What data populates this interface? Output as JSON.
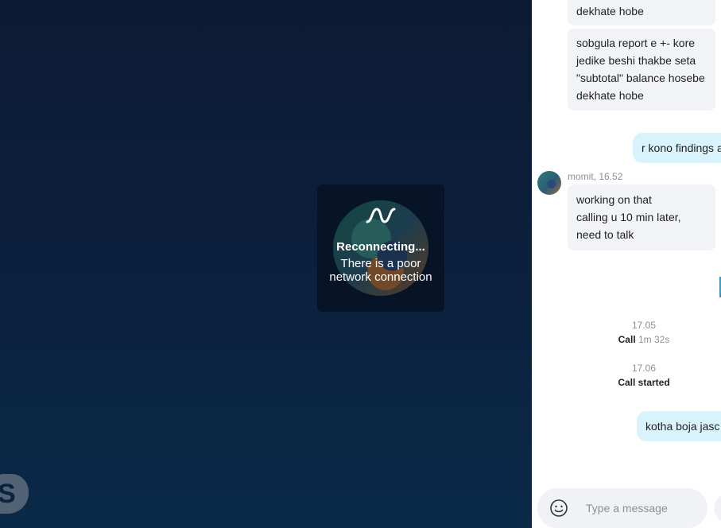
{
  "call": {
    "status_title": "Reconnecting...",
    "status_message": "There is a poor network connection",
    "logo_letter": "S"
  },
  "chat": {
    "messages_in_top": [
      "dekhate hobe",
      "sobgula report e +- kore jedike beshi thakbe seta \"subtotal\" balance hosebe dekhate hobe"
    ],
    "out_1": "r kono findings a",
    "sender": {
      "name_time": "momit, 16.52"
    },
    "message_in_2": "working on that calling u 10 min later, need to talk",
    "events": [
      {
        "time": "17.05",
        "label": "Call",
        "detail": "1m 32s"
      },
      {
        "time": "17.06",
        "label": "Call started",
        "detail": ""
      }
    ],
    "out_2": "kotha boja jasc",
    "composer": {
      "placeholder": "Type a message"
    }
  },
  "icons": {
    "wave": "audio-wave-icon",
    "emoji": "smiley-icon",
    "logo": "skype-logo-icon"
  },
  "colors": {
    "stage_bg": "#0b213d",
    "outgoing_bubble": "#d9f3fd",
    "incoming_bubble": "#f1f3f7",
    "accent": "#1ea4d8"
  }
}
